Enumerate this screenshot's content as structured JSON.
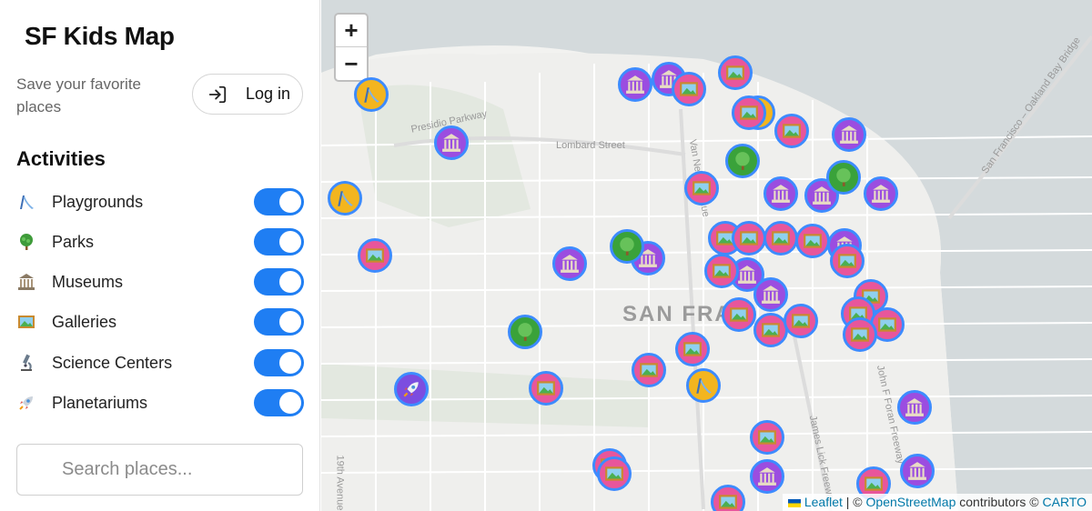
{
  "sidebar": {
    "title": "SF Kids Map",
    "save_text": "Save your favorite places",
    "login_label": "Log in",
    "activities_title": "Activities",
    "activities": [
      {
        "label": "Playgrounds",
        "icon": "slide-icon",
        "enabled": true
      },
      {
        "label": "Parks",
        "icon": "tree-icon",
        "enabled": true
      },
      {
        "label": "Museums",
        "icon": "museum-icon",
        "enabled": true
      },
      {
        "label": "Galleries",
        "icon": "picture-icon",
        "enabled": true
      },
      {
        "label": "Science Centers",
        "icon": "microscope-icon",
        "enabled": true
      },
      {
        "label": "Planetariums",
        "icon": "rocket-icon",
        "enabled": true
      }
    ],
    "search_placeholder": "Search places..."
  },
  "map": {
    "zoom_in": "+",
    "zoom_out": "−",
    "city_label": "SAN FRA",
    "streets": [
      "Lombard Street",
      "Presidio Parkway",
      "Van Ness Avenue",
      "San Francisco – Oakland Bay Bridge",
      "James Lick Freeway",
      "John F Foran Freeway",
      "19th Avenue"
    ],
    "attribution": {
      "leaflet": "Leaflet",
      "sep1": " | © ",
      "osm": "OpenStreetMap",
      "mid": " contributors © ",
      "carto": "CARTO"
    },
    "colors": {
      "museum": "#9b4de0",
      "gallery": "#e8569b",
      "park": "#3aa23a",
      "playground": "#f3b51f",
      "toggle": "#1f7ef3",
      "water": "#d4dadc"
    }
  }
}
